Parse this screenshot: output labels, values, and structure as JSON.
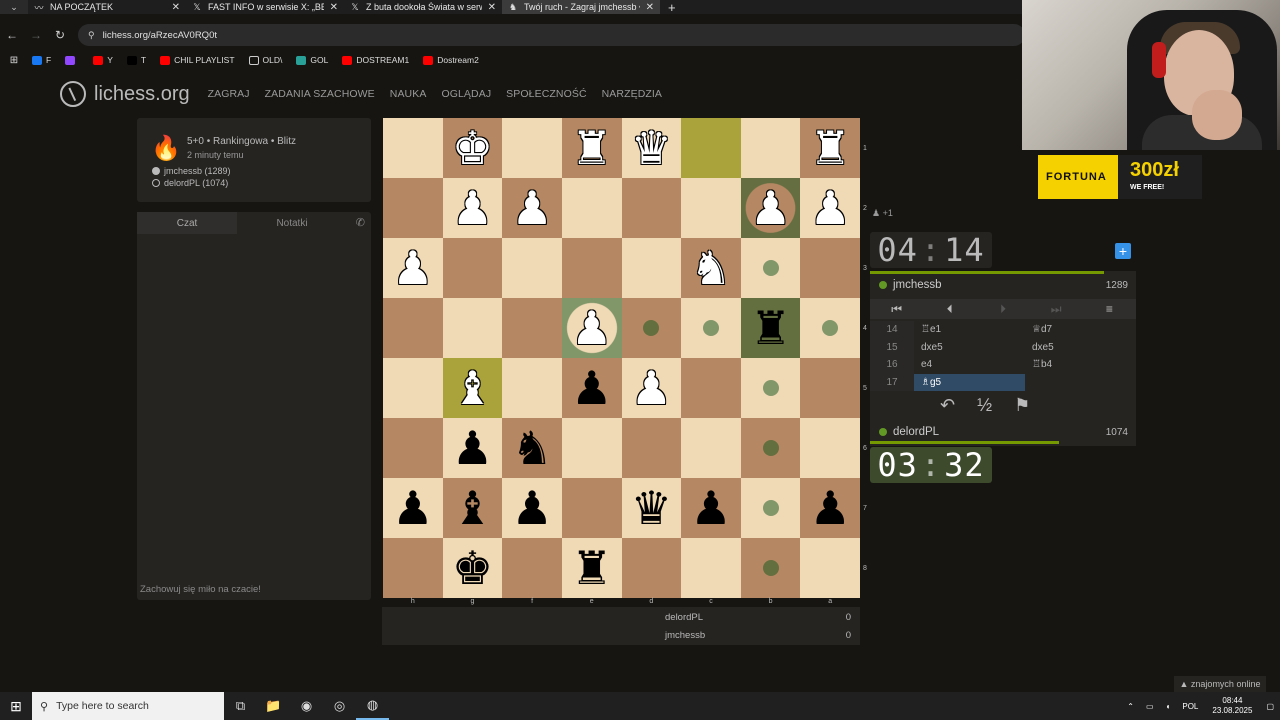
{
  "browser": {
    "tabs": [
      {
        "title": "NA POCZĄTEK",
        "icon": "wave-icon",
        "active": false
      },
      {
        "title": "FAST INFO w serwisie X: „BESTI",
        "icon": "x-logo-icon",
        "active": false
      },
      {
        "title": "Z buta dookoła Świata w serwis",
        "icon": "x-logo-icon",
        "active": false
      },
      {
        "title": "Twój ruch - Zagraj jmchessb • li",
        "icon": "lichess-icon",
        "active": true
      }
    ],
    "url": "lichess.org/aRzecAV0RQ0t",
    "bookmarks": [
      {
        "label": "F",
        "color": "#1877f2"
      },
      {
        "label": "",
        "color": "#9146ff"
      },
      {
        "label": "Y",
        "color": "#ff0000"
      },
      {
        "label": "T",
        "color": "#000000"
      },
      {
        "label": "CHIL PLAYLIST",
        "color": "#ff0000"
      },
      {
        "label": "OLD\\",
        "color": "folder"
      },
      {
        "label": "GOL",
        "color": "#2aa198"
      },
      {
        "label": "DOSTREAM1",
        "color": "#ff0000"
      },
      {
        "label": "Dostream2",
        "color": "#ff0000"
      }
    ]
  },
  "site": {
    "logo": "lichess.org",
    "nav": [
      "ZAGRAJ",
      "ZADANIA SZACHOWE",
      "NAUKA",
      "OGLĄDAJ",
      "SPOŁECZNOŚĆ",
      "NARZĘDZIA"
    ]
  },
  "game_info": {
    "mode": "5+0 • Rankingowa • Blitz",
    "time_ago": "2 minuty temu",
    "white_player": "jmchessb (1289)",
    "black_player": "delordPL (1074)"
  },
  "chat": {
    "tab_chat": "Czat",
    "tab_notes": "Notatki",
    "hint": "Zachowuj się miło na czacie!"
  },
  "board": {
    "ranks": [
      [
        "",
        "wK",
        "",
        "wR",
        "wQ",
        "hl",
        "",
        "wR"
      ],
      [
        "",
        "wP",
        "wP",
        "",
        "",
        "",
        "wP*",
        "wP"
      ],
      [
        "wP",
        "",
        "",
        "",
        "",
        "wN",
        ".",
        ""
      ],
      [
        "",
        "",
        "",
        "wP*",
        ".",
        ".",
        "bR!",
        "."
      ],
      [
        "",
        "wB#",
        "",
        "bP",
        "wP",
        "",
        ".",
        ""
      ],
      [
        "",
        "bP",
        "bN",
        "",
        "",
        "",
        ".",
        ""
      ],
      [
        "bP",
        "bB",
        "bP",
        "",
        "bQ",
        "bP",
        ".",
        "bP"
      ],
      [
        "",
        "bK",
        "",
        "bR",
        "",
        "",
        ".",
        ""
      ]
    ],
    "files": [
      "h",
      "g",
      "f",
      "e",
      "d",
      "c",
      "b",
      "a"
    ],
    "rank_labels": [
      "1",
      "2",
      "3",
      "4",
      "5",
      "6",
      "7",
      "8"
    ]
  },
  "scores": [
    {
      "name": "delordPL",
      "score": "0"
    },
    {
      "name": "jmchessb",
      "score": "0"
    }
  ],
  "right_panel": {
    "spectators": "+1",
    "top_clock": {
      "min": "04",
      "sec": "14"
    },
    "bottom_clock": {
      "min": "03",
      "sec": "32"
    },
    "top_player": {
      "name": "jmchessb",
      "rating": "1289",
      "bar": 0.88
    },
    "bottom_player": {
      "name": "delordPL",
      "rating": "1074",
      "bar": 0.71
    },
    "moves": [
      {
        "n": "14",
        "w": "♖e1",
        "b": "♕d7"
      },
      {
        "n": "15",
        "w": "dxe5",
        "b": "dxe5"
      },
      {
        "n": "16",
        "w": "e4",
        "b": "♖b4"
      },
      {
        "n": "17",
        "w": "♗g5",
        "b": ""
      }
    ],
    "draw_label": "½"
  },
  "ad": {
    "brand": "FORTUNA",
    "amount": "300zł",
    "sub": "WE FREE!"
  },
  "friends": "▲ znajomych online",
  "taskbar": {
    "search_placeholder": "Type here to search",
    "lang": "POL",
    "time": "08:44",
    "date": "23.08.2025"
  }
}
